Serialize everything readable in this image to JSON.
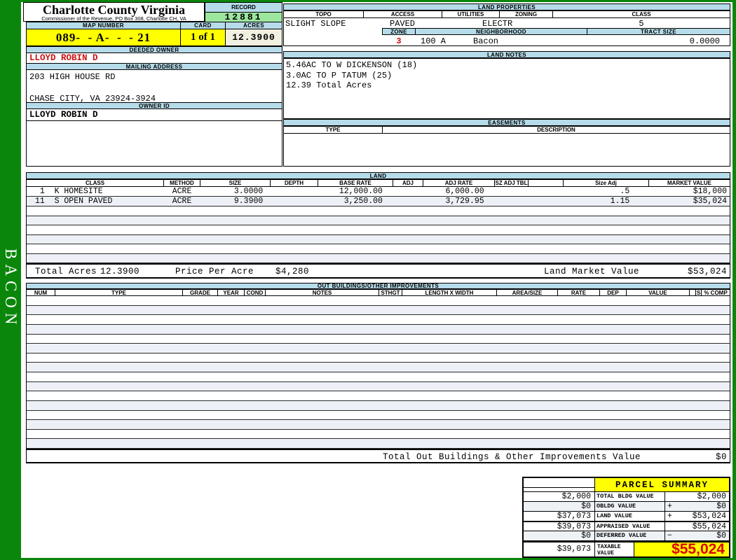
{
  "sidebar": {
    "district": "BACON"
  },
  "header": {
    "county": "Charlotte County Virginia",
    "commissioner": "Commissioner of the Revenue, PO Box 308, Charlotte CH, VA",
    "record_label": "RECORD",
    "record_value": "12881",
    "map_number_label": "MAP NUMBER",
    "map_number": "089-  - A-  -  - 21",
    "card_label": "CARD",
    "card": "1 of 1",
    "acres_label": "ACRES",
    "acres": "12.3900"
  },
  "owner": {
    "deeded_owner_label": "DEEDED OWNER",
    "deeded_owner": "LLOYD ROBIN D",
    "mailing_address_label": "MAILING ADDRESS",
    "address_line1": "203 HIGH HOUSE RD",
    "address_line2": "CHASE CITY, VA 23924-3924",
    "owner_id_label": "OWNER ID",
    "owner_id": "LLOYD ROBIN D"
  },
  "land_properties": {
    "title": "LAND PROPERTIES",
    "topo_label": "TOPO",
    "topo": "SLIGHT SLOPE",
    "access_label": "ACCESS",
    "access": "PAVED",
    "utilities_label": "UTILITIES",
    "utilities": "ELECTR",
    "zoning_label": "ZONING",
    "zoning": "",
    "class_label": "CLASS",
    "class": "5",
    "zone_label": "ZONE",
    "zone": "3",
    "zone_code": "100 A",
    "neighborhood_label": "NEIGHBORHOOD",
    "neighborhood": "Bacon",
    "tract_size_label": "TRACT SIZE",
    "tract_size": "0.0000"
  },
  "land_notes": {
    "title": "LAND NOTES",
    "lines": [
      "5.46AC TO W DICKENSON (18)",
      "3.0AC TO P TATUM (25)",
      "12.39 Total Acres"
    ]
  },
  "easements": {
    "title": "EASEMENTS",
    "type_label": "TYPE",
    "description_label": "DESCRIPTION"
  },
  "land_table": {
    "title": "LAND",
    "columns": [
      "CLASS",
      "METHOD",
      "SIZE",
      "DEPTH",
      "BASE RATE",
      "ADJ",
      "ADJ RATE",
      "SZ ADJ TBL",
      "",
      "Size Adj",
      "MARKET VALUE"
    ],
    "rows": [
      {
        "class": " 1  K HOMESITE",
        "method": "ACRE",
        "size": "3.0000",
        "depth": "",
        "base_rate": "12,000.00",
        "adj": "",
        "adj_rate": "6,000.00",
        "sz_adj_tbl": "",
        "gap": "",
        "size_adj": ".5",
        "market_value": "$18,000"
      },
      {
        "class": "11  S OPEN PAVED",
        "method": "ACRE",
        "size": "9.3900",
        "depth": "",
        "base_rate": "3,250.00",
        "adj": "",
        "adj_rate": "3,729.95",
        "sz_adj_tbl": "",
        "gap": "",
        "size_adj": "1.15",
        "market_value": "$35,024"
      }
    ],
    "empty_rows": 6,
    "totals": {
      "total_acres_label": "Total Acres",
      "total_acres": "12.3900",
      "price_per_acre_label": "Price Per Acre",
      "price_per_acre": "$4,280",
      "land_market_value_label": "Land Market Value",
      "land_market_value": "$53,024"
    }
  },
  "out_buildings": {
    "title": "OUT BUILDINGS/OTHER IMPROVEMENTS",
    "columns": [
      "NUM",
      "TYPE",
      "GRADE",
      "YEAR",
      "COND",
      "NOTES",
      "STHGT",
      "LENGTH X WIDTH",
      "AREA/SIZE",
      "RATE",
      "DEP",
      "VALUE",
      "",
      "S",
      "% COMP"
    ],
    "empty_rows": 16,
    "total_label": "Total Out Buildings & Other Improvements Value",
    "total_value": "$0"
  },
  "parcel_summary": {
    "title": "PARCEL SUMMARY",
    "rows": [
      {
        "prior": "$2,000",
        "label": "TOTAL BLDG VALUE",
        "op": "",
        "value": "$2,000"
      },
      {
        "prior": "$0",
        "label": "OBLDG VALUE",
        "op": "+",
        "value": "$0"
      },
      {
        "prior": "$37,073",
        "label": "LAND VALUE",
        "op": "+",
        "value": "$53,024"
      },
      {
        "prior": "$39,073",
        "label": "APPRAISED VALUE",
        "op": "",
        "value": "$55,024"
      },
      {
        "prior": "$0",
        "label": "DEFERRED VALUE",
        "op": "−",
        "value": "$0"
      }
    ],
    "taxable": {
      "prior": "$39,073",
      "label": "TAXABLE VALUE",
      "value": "$55,024"
    }
  },
  "colors": {
    "border_green": "#0a860a",
    "header_blue": "#b6dbe9",
    "record_green": "#9de69e",
    "highlight_yellow": "#ffff00",
    "acres_cream": "#f1f0e1",
    "alert_red": "#dd0000",
    "owner_red": "#cc1111"
  }
}
